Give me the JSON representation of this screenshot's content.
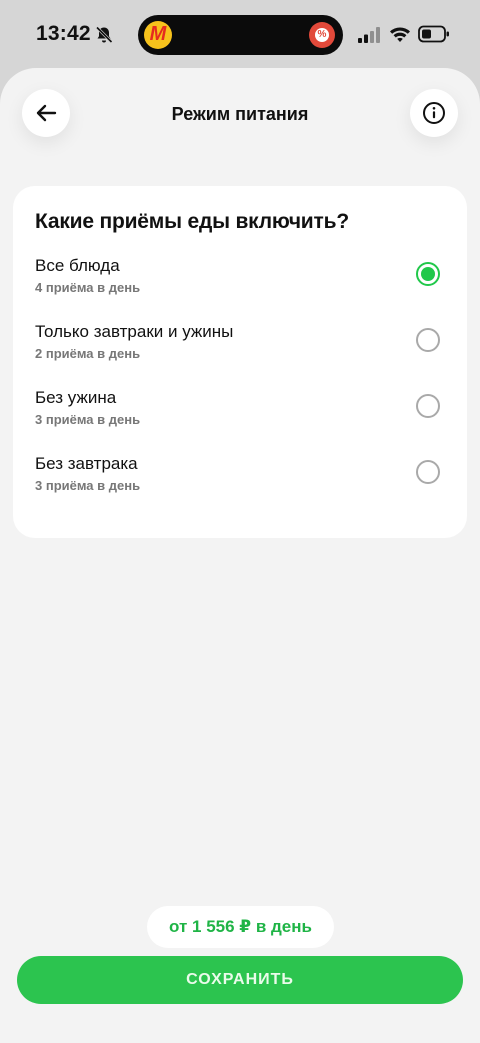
{
  "status_bar": {
    "time": "13:42",
    "bell_icon": "bell-slash-icon",
    "island_left_icon": "yandex-market-icon",
    "island_right_icon": "discount-icon",
    "signal_icon": "cellular-signal-icon",
    "wifi_icon": "wifi-icon",
    "battery_icon": "battery-icon"
  },
  "header": {
    "title": "Режим питания",
    "back_icon": "arrow-left-icon",
    "info_icon": "info-icon"
  },
  "card": {
    "title": "Какие приёмы еды включить?",
    "options": [
      {
        "label": "Все блюда",
        "sub": "4 приёма в день",
        "selected": true
      },
      {
        "label": "Только завтраки и ужины",
        "sub": "2 приёма в день",
        "selected": false
      },
      {
        "label": "Без ужина",
        "sub": "3 приёма в день",
        "selected": false
      },
      {
        "label": "Без завтрака",
        "sub": "3 приёма в день",
        "selected": false
      }
    ]
  },
  "footer": {
    "price": "от 1 556 ₽ в день",
    "save_label": "СОХРАНИТЬ"
  },
  "colors": {
    "accent": "#2cc44f",
    "price_text": "#1fb446",
    "radio_selected": "#21c84a"
  }
}
